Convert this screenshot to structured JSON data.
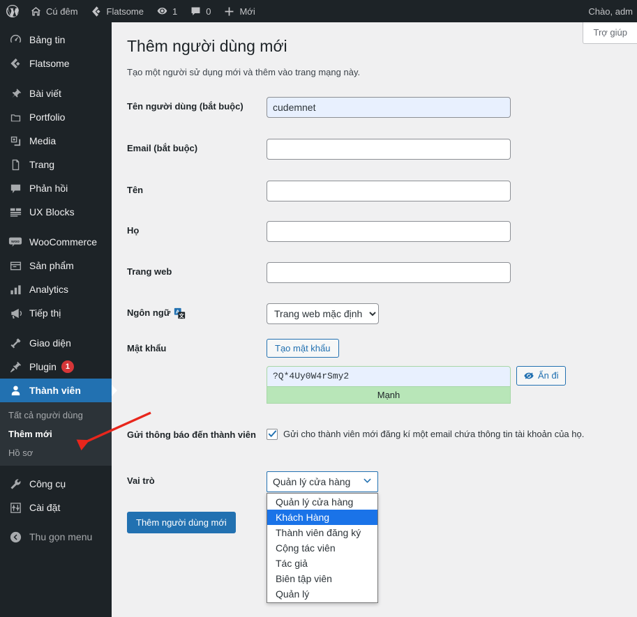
{
  "adminbar": {
    "logo_icon": "wordpress-logo-icon",
    "items": [
      {
        "icon": "home-icon",
        "label": "Cú đêm"
      },
      {
        "icon": "flatsome-icon",
        "label": "Flatsome"
      },
      {
        "icon": "updates-icon",
        "label": "1"
      },
      {
        "icon": "comment-icon",
        "label": "0"
      },
      {
        "icon": "plus-icon",
        "label": "Mới"
      }
    ],
    "greeting": "Chào, adm"
  },
  "sidebar": {
    "items": [
      {
        "icon": "dashboard-icon",
        "label": "Bảng tin",
        "current": false,
        "badge": ""
      },
      {
        "icon": "flatsome-icon",
        "label": "Flatsome",
        "current": false,
        "badge": ""
      },
      {
        "icon": "pin-icon",
        "label": "Bài viết",
        "current": false,
        "badge": ""
      },
      {
        "icon": "portfolio-icon",
        "label": "Portfolio",
        "current": false,
        "badge": ""
      },
      {
        "icon": "media-icon",
        "label": "Media",
        "current": false,
        "badge": ""
      },
      {
        "icon": "page-icon",
        "label": "Trang",
        "current": false,
        "badge": ""
      },
      {
        "icon": "comment-icon",
        "label": "Phản hồi",
        "current": false,
        "badge": ""
      },
      {
        "icon": "ux-blocks-icon",
        "label": "UX Blocks",
        "current": false,
        "badge": ""
      },
      {
        "icon": "woocommerce-icon",
        "label": "WooCommerce",
        "current": false,
        "badge": ""
      },
      {
        "icon": "products-icon",
        "label": "Sản phẩm",
        "current": false,
        "badge": ""
      },
      {
        "icon": "analytics-icon",
        "label": "Analytics",
        "current": false,
        "badge": ""
      },
      {
        "icon": "marketing-icon",
        "label": "Tiếp thị",
        "current": false,
        "badge": ""
      },
      {
        "icon": "appearance-icon",
        "label": "Giao diện",
        "current": false,
        "badge": ""
      },
      {
        "icon": "plugin-icon",
        "label": "Plugin",
        "current": false,
        "badge": "1"
      },
      {
        "icon": "users-icon",
        "label": "Thành viên",
        "current": true,
        "badge": ""
      }
    ],
    "submenu": [
      {
        "label": "Tất cả người dùng",
        "current": false
      },
      {
        "label": "Thêm mới",
        "current": true
      },
      {
        "label": "Hồ sơ",
        "current": false
      }
    ],
    "items_after": [
      {
        "icon": "tools-icon",
        "label": "Công cụ"
      },
      {
        "icon": "settings-icon",
        "label": "Cài đặt"
      }
    ],
    "collapse": {
      "icon": "collapse-icon",
      "label": "Thu gọn menu"
    }
  },
  "help_tab": {
    "label": "Trợ giúp"
  },
  "page": {
    "title": "Thêm người dùng mới",
    "subtitle": "Tạo một người sử dụng mới và thêm vào trang mạng này."
  },
  "form": {
    "username": {
      "label": "Tên người dùng (bắt buộc)",
      "value": "cudemnet",
      "placeholder": ""
    },
    "email": {
      "label": "Email (bắt buộc)",
      "value": "",
      "placeholder": ""
    },
    "firstname": {
      "label": "Tên",
      "value": "",
      "placeholder": ""
    },
    "lastname": {
      "label": "Họ",
      "value": "",
      "placeholder": ""
    },
    "website": {
      "label": "Trang web",
      "value": "",
      "placeholder": ""
    },
    "language": {
      "label": "Ngôn ngữ",
      "icon": "translate-icon",
      "selected": "Trang web mặc định",
      "options": [
        "Trang web mặc định"
      ]
    },
    "password": {
      "label": "Mật khẩu",
      "generate_button": "Tạo mật khẩu",
      "value": "?Q*4Uy0W4rSmy2",
      "strength": "Mạnh",
      "hide_button": "Ẩn đi",
      "hide_icon": "eye-slash-icon",
      "strength_color": "#b8e6b8"
    },
    "notification": {
      "label": "Gửi thông báo đến thành viên",
      "checkbox_label": "Gửi cho thành viên mới đăng kí một email chứa thông tin tài khoản của họ.",
      "checked": true
    },
    "role": {
      "label": "Vai trò",
      "selected": "Quản lý cửa hàng",
      "open": true,
      "highlighted": "Khách Hàng",
      "options": [
        "Quản lý cửa hàng",
        "Khách Hàng",
        "Thành viên đăng ký",
        "Cộng tác viên",
        "Tác giả",
        "Biên tập viên",
        "Quản lý"
      ]
    },
    "submit": {
      "label": "Thêm người dùng mới"
    }
  },
  "annotation": {
    "arrow_color": "#e8261c",
    "points_to": "Thêm mới"
  },
  "colors": {
    "admin_bar_bg": "#1d2327",
    "sidebar_bg": "#1d2327",
    "submenu_bg": "#2c3338",
    "accent_blue": "#2271b1",
    "content_bg": "#f0f0f1",
    "badge_red": "#d63638",
    "highlight_blue": "#1a73e8"
  }
}
